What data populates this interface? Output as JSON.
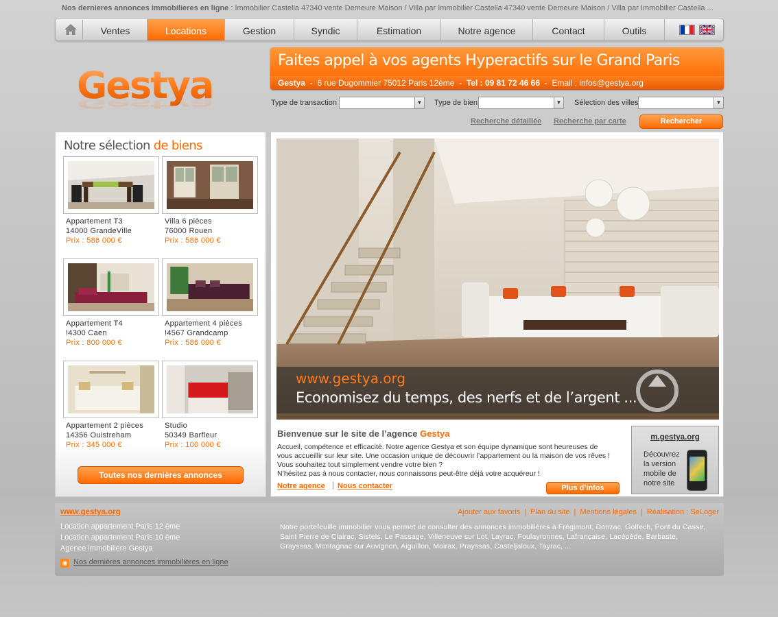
{
  "ticker": {
    "label": "Nos dernieres annonces immobilieres en ligne",
    "text": " :  Immobilier Castella 47340 vente Demeure Maison / Villa  par  Immobilier Castella 47340 vente Demeure Maison / Villa par  Immobilier Castella ..."
  },
  "nav": {
    "items": [
      {
        "label": "Ventes"
      },
      {
        "label": "Locations"
      },
      {
        "label": "Gestion"
      },
      {
        "label": "Syndic"
      },
      {
        "label": "Estimation"
      },
      {
        "label": "Notre agence"
      },
      {
        "label": "Contact"
      },
      {
        "label": "Outils"
      }
    ],
    "active": "Locations"
  },
  "logo": {
    "text": "Gestya"
  },
  "banner": {
    "title": "Faites appel à vos agents Hyperactifs sur le Grand Paris",
    "agency": "Gestya",
    "address": "6 rue Dugommier 75012 Paris 12ème",
    "tel": "Tel : 09 81 72 46 66",
    "email": "Email : infos@gestya.org"
  },
  "search": {
    "transaction_label": "Type de transaction",
    "bien_label": "Type de bien",
    "villes_label": "Sélection des villes",
    "detailed_link": "Recherche détaillée",
    "map_link": "Recherche par carte",
    "button": "Rechercher"
  },
  "selection": {
    "title_part1": "Notre sélection ",
    "title_part2": "de biens",
    "properties": [
      {
        "name": "Appartement T3",
        "city": "14000 GrandeVille",
        "price": "Prix : 586 000 €"
      },
      {
        "name": "Villa 6 pièces",
        "city": "76000 Rouen",
        "price": "Prix : 586 000 €"
      },
      {
        "name": "Appartement T4",
        "city": "!4300 Caen",
        "price": "Prix : 800 000 €"
      },
      {
        "name": "Appartement 4 pièces",
        "city": "!4567 Grandcamp",
        "price": "Prix : 586 000 €"
      },
      {
        "name": "Appartement 2 pièces",
        "city": "14356 Ouistreham",
        "price": "Prix : 345 000 €"
      },
      {
        "name": "Studio",
        "city": "50349 Barfleur",
        "price": "Prix : 100 000 €"
      }
    ],
    "all_button": "Toutes nos dernières annonces"
  },
  "hero": {
    "site": "www.gestya.org",
    "slogan": "Economisez du temps, des nerfs et de l’argent ..."
  },
  "welcome": {
    "title": "Bienvenue sur le site de l’agence ",
    "brand": "Gestya",
    "lines": [
      "Accueil, compétence et efficacité. Notre agence Gestya et son équipe dynamique sont heureuses de",
      "vous accueillir sur leur site. Une occasion unique de découvrir l’appartement ou la maison de vos rêves !",
      "Vous souhaitez tout simplement vendre votre bien ?",
      "N’hésitez pas à nous contacter, nous connaissons peut-être déjà votre acquéreur !"
    ],
    "link_agence": "Notre agence",
    "link_contact": "Nous contacter",
    "more_button": "Plus d’infos"
  },
  "mobile": {
    "title": "m.gestya.org",
    "desc_lines": [
      "Découvrez",
      "la version",
      "mobile de",
      "notre site"
    ]
  },
  "footer": {
    "site": "www.gestya.org",
    "links": [
      "Location appartement Paris 12 ème",
      "Location appartement Paris 10 ème",
      "Agence immobiliere Gestya"
    ],
    "rss": "Nos dernières annonces immobilières en ligne",
    "right_links": [
      "Ajouter aux favoris",
      "Plan du site",
      "Mentions légales",
      "Réalisation : SeLoger"
    ],
    "portfolio_lines": [
      "Notre portefeuille immobilier vous permet de consulter des annonces immobilières à  Frégimont,  Donzac,  Golfech,  Pont du Casse,",
      "Saint Pierre de Clairac,  Sistels,  Le Passage,  Villeneuve sur Lot,  Layrac,  Foulayronnes,  Lafrançaise,  Lacépède,  Barbaste,",
      "Grayssas,  Montagnac sur Auvignon,  Aiguillon,  Moirax,  Prayssas,  Casteljaloux,  Tayrac,  ..."
    ]
  },
  "colors": {
    "accent": "#ff6a00",
    "background": "#c4c4c4"
  }
}
